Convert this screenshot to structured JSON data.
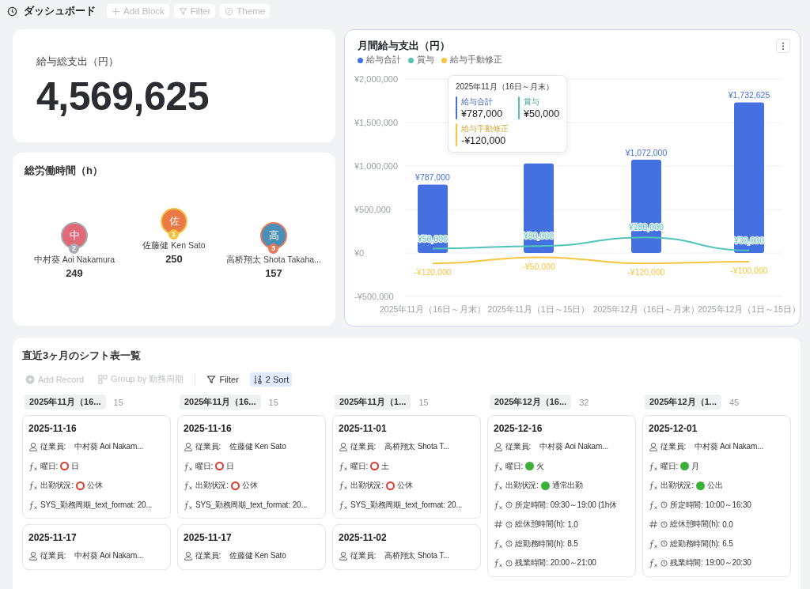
{
  "topbar": {
    "title": "ダッシュボード",
    "buttons": [
      {
        "label": "Add Block",
        "kind": "add"
      },
      {
        "label": "Filter",
        "kind": "filter"
      },
      {
        "label": "Theme",
        "kind": "theme"
      }
    ]
  },
  "total_card": {
    "title": "給与総支出（円）",
    "value": "4,569,625"
  },
  "hours_card": {
    "title": "総労働時間（h）",
    "people": [
      {
        "initial": "中",
        "rank": "2",
        "kind": "silver",
        "name": "中村葵 Aoi Nakamura",
        "hours": "249",
        "color": "#e06a78"
      },
      {
        "initial": "佐",
        "rank": "1",
        "kind": "gold",
        "name": "佐藤健 Ken Sato",
        "hours": "250",
        "color": "#ea7a45"
      },
      {
        "initial": "高",
        "rank": "3",
        "kind": "bronze",
        "name": "高桥翔太 Shota Takaha...",
        "hours": "157",
        "color": "#4a8fb8"
      }
    ]
  },
  "chart_card": {
    "title": "月間給与支出（円）",
    "chart_data": {
      "type": "bar",
      "grid": true,
      "categories": [
        "2025年11月（16日～月末）",
        "2025年11月（1日～15日）",
        "2025年12月（16日～月末）",
        "2025年12月（1日～15日）"
      ],
      "ylim": [
        -500000,
        2000000
      ],
      "yticks": [
        {
          "value": 2000000,
          "label": "¥2,000,000"
        },
        {
          "value": 1500000,
          "label": "¥1,500,000"
        },
        {
          "value": 1000000,
          "label": "¥1,000,000"
        },
        {
          "value": 500000,
          "label": "¥500,000"
        },
        {
          "value": 0,
          "label": "¥0"
        },
        {
          "value": -500000,
          "label": "-¥500,000"
        }
      ],
      "series": [
        {
          "name": "給与合計",
          "color": "#4470e0",
          "values": [
            787000,
            1030000,
            1072000,
            1732625
          ],
          "value_labels": [
            "¥787,000",
            null,
            "¥1,072,000",
            "¥1,732,625"
          ]
        },
        {
          "name": "賞与",
          "type": "line",
          "color": "#52c3b8",
          "values": [
            50000,
            80000,
            180000,
            30000
          ],
          "value_labels": [
            "¥50,000",
            "¥80,000",
            "¥180,000",
            "¥30,000"
          ]
        },
        {
          "name": "給与手動修正",
          "type": "line",
          "color": "#f5c542",
          "values": [
            -120000,
            -50000,
            -120000,
            -100000
          ],
          "value_labels": [
            "-¥120,000",
            "-¥50,000",
            "-¥120,000",
            "-¥100,000"
          ]
        }
      ]
    },
    "tooltip": {
      "title": "2025年11月（16日～月末）",
      "entries": [
        {
          "label": "給与合計",
          "value": "¥787,000",
          "color": "#4470e0"
        },
        {
          "label": "賞与",
          "value": "¥50,000",
          "color": "#52c3b8"
        },
        {
          "label": "給与手動修正",
          "value": "-¥120,000",
          "color": "#f5c542"
        }
      ]
    }
  },
  "board": {
    "title": "直近3ヶ月のシフト表一覧",
    "toolbar": [
      {
        "label": "Add Record",
        "kind": "add",
        "disabled": true,
        "selected": false
      },
      {
        "label": "Group by 勤務周期",
        "kind": "group",
        "disabled": true,
        "selected": false
      },
      {
        "label": "Filter",
        "kind": "filter",
        "disabled": false,
        "selected": false
      },
      {
        "label": "2 Sort",
        "kind": "sort",
        "disabled": false,
        "selected": true
      }
    ],
    "groups": [
      {
        "label": "2025年11月（16...",
        "count": "15",
        "cards": [
          {
            "date": "2025-11-16",
            "fields": [
              {
                "kind": "person",
                "label": "従業員:",
                "value": "中村葵 Aoi Nakam..."
              },
              {
                "kind": "formula",
                "label": "曜日:",
                "hollow": true,
                "color": "#e0392b",
                "value": "日"
              },
              {
                "kind": "formula",
                "label": "出勤状況:",
                "hollow": true,
                "color": "#e0392b",
                "value": "公休"
              },
              {
                "kind": "formula",
                "label": "SYS_勤務周期_text_format:",
                "value": "20..."
              }
            ]
          },
          {
            "date": "2025-11-17",
            "fields": [
              {
                "kind": "person",
                "label": "従業員:",
                "value": "中村葵 Aoi Nakam..."
              }
            ]
          }
        ]
      },
      {
        "label": "2025年11月（16...",
        "count": "15",
        "cards": [
          {
            "date": "2025-11-16",
            "fields": [
              {
                "kind": "person",
                "label": "従業員:",
                "value": "佐藤健 Ken Sato"
              },
              {
                "kind": "formula",
                "label": "曜日:",
                "hollow": true,
                "color": "#e0392b",
                "value": "日"
              },
              {
                "kind": "formula",
                "label": "出勤状況:",
                "hollow": true,
                "color": "#e0392b",
                "value": "公休"
              },
              {
                "kind": "formula",
                "label": "SYS_勤務周期_text_format:",
                "value": "20..."
              }
            ]
          },
          {
            "date": "2025-11-17",
            "fields": [
              {
                "kind": "person",
                "label": "従業員:",
                "value": "佐藤健 Ken Sato"
              }
            ]
          }
        ]
      },
      {
        "label": "2025年11月（1...",
        "count": "15",
        "cards": [
          {
            "date": "2025-11-01",
            "fields": [
              {
                "kind": "person",
                "label": "従業員:",
                "value": "高桥翔太 Shota T..."
              },
              {
                "kind": "formula",
                "label": "曜日:",
                "hollow": true,
                "color": "#e0392b",
                "value": "土"
              },
              {
                "kind": "formula",
                "label": "出勤状況:",
                "hollow": true,
                "color": "#e0392b",
                "value": "公休"
              },
              {
                "kind": "formula",
                "label": "SYS_勤務周期_text_format:",
                "value": "20..."
              }
            ]
          },
          {
            "date": "2025-11-02",
            "fields": [
              {
                "kind": "person",
                "label": "従業員:",
                "value": "高桥翔太 Shota T..."
              }
            ]
          }
        ]
      },
      {
        "label": "2025年12月（16...",
        "count": "32",
        "cards": [
          {
            "date": "2025-12-16",
            "fields": [
              {
                "kind": "person",
                "label": "従業員:",
                "value": "中村葵 Aoi Nakam..."
              },
              {
                "kind": "formula",
                "label": "曜日:",
                "hollow": false,
                "color": "#3cae3a",
                "value": "火"
              },
              {
                "kind": "formula",
                "label": "出勤状況:",
                "hollow": false,
                "color": "#3cae3a",
                "value": "通常出勤"
              },
              {
                "kind": "formula",
                "clock": true,
                "label": "所定時間:",
                "value": "09:30～19:00 (1h休"
              },
              {
                "kind": "number",
                "clock": true,
                "label": "総休憩時間(h):",
                "value": "1.0"
              },
              {
                "kind": "formula",
                "clock": true,
                "label": "総勤務時間(h):",
                "value": "8.5"
              },
              {
                "kind": "formula",
                "clock": true,
                "label": "残業時間:",
                "value": "20:00～21:00"
              }
            ]
          }
        ]
      },
      {
        "label": "2025年12月（1...",
        "count": "45",
        "cards": [
          {
            "date": "2025-12-01",
            "fields": [
              {
                "kind": "person",
                "label": "従業員:",
                "value": "中村葵 Aoi Nakam..."
              },
              {
                "kind": "formula",
                "label": "曜日:",
                "hollow": false,
                "color": "#3cae3a",
                "value": "月"
              },
              {
                "kind": "formula",
                "label": "出勤状況:",
                "hollow": false,
                "color": "#3cae3a",
                "value": "公出"
              },
              {
                "kind": "formula",
                "clock": true,
                "label": "所定時間:",
                "value": "10:00～16:30"
              },
              {
                "kind": "number",
                "clock": true,
                "label": "総休憩時間(h):",
                "value": "0.0"
              },
              {
                "kind": "formula",
                "clock": true,
                "label": "総勤務時間(h):",
                "value": "6.5"
              },
              {
                "kind": "formula",
                "clock": true,
                "label": "残業時間:",
                "value": "19:00～20:30"
              }
            ]
          }
        ]
      }
    ]
  }
}
